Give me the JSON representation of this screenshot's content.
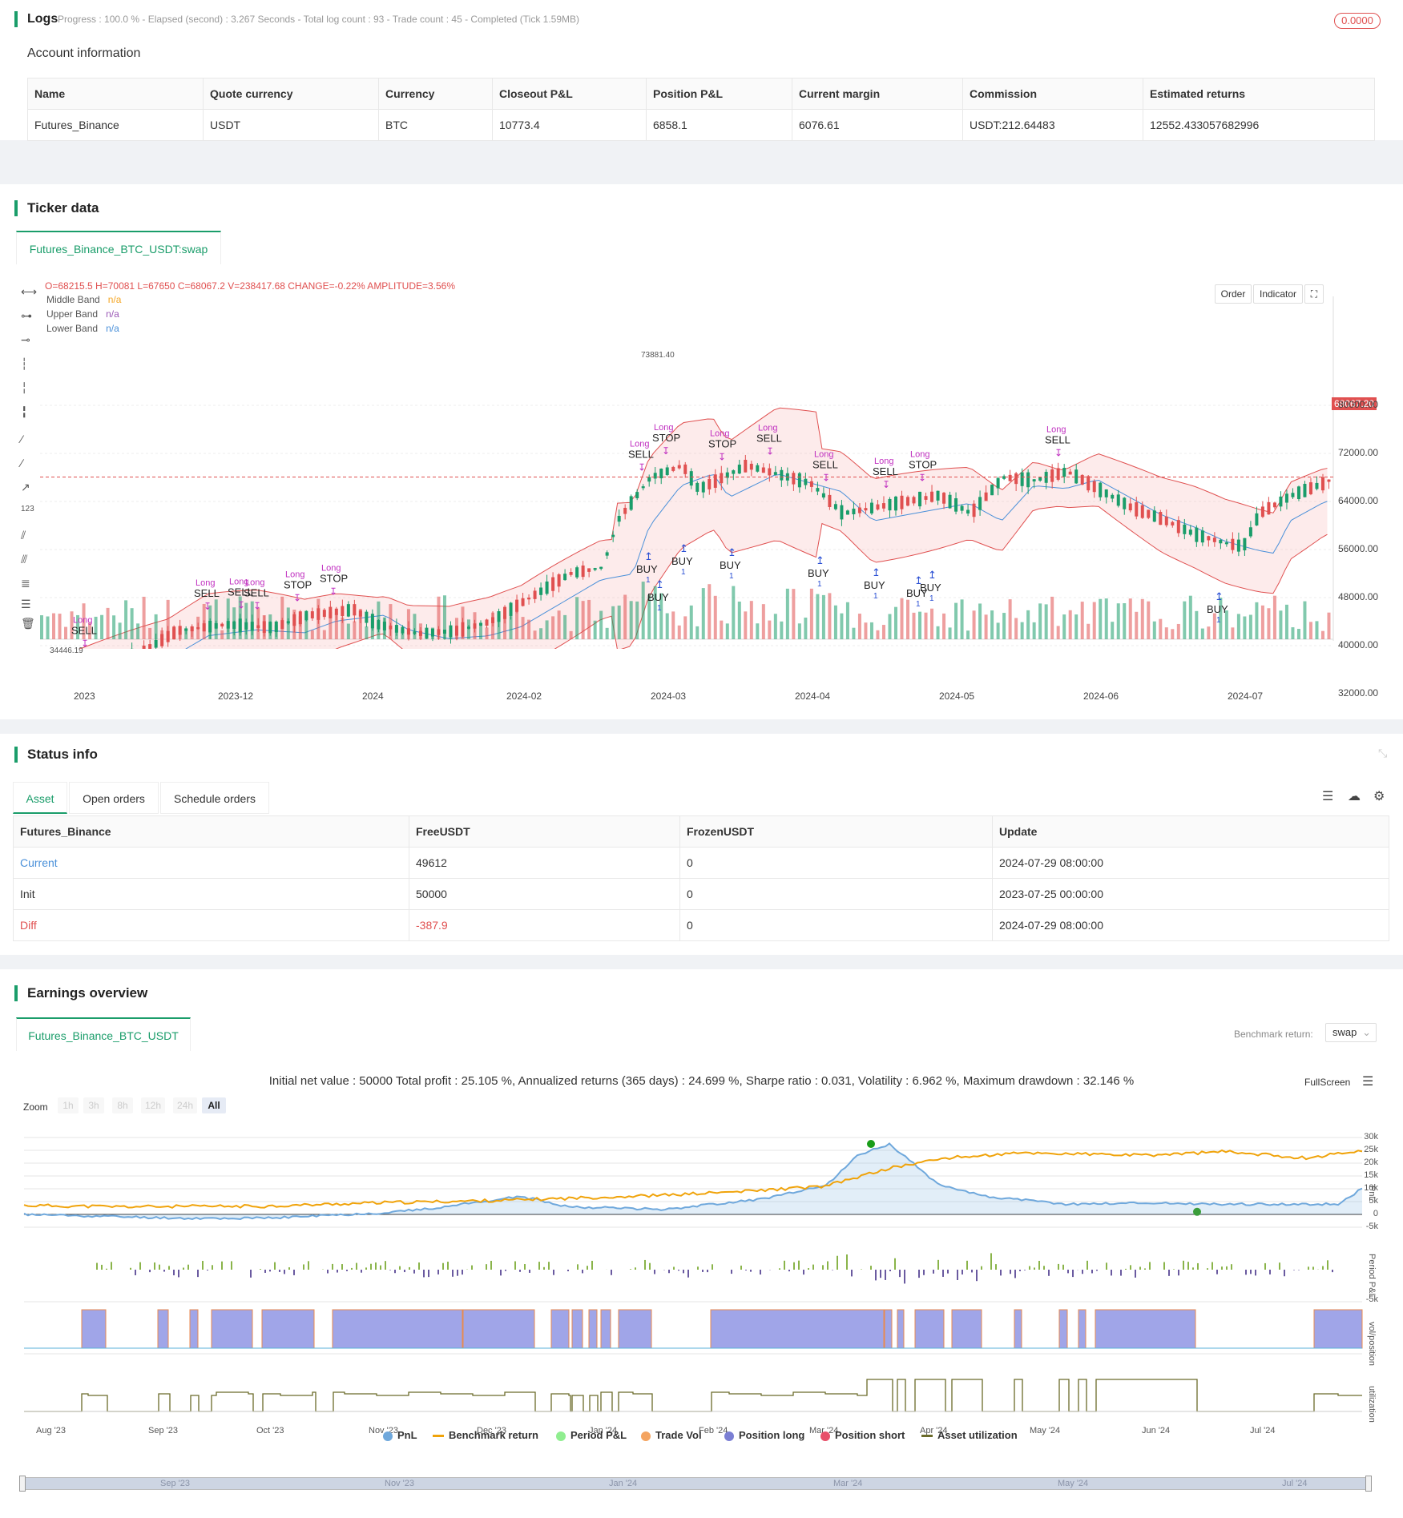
{
  "logs": {
    "title": "Logs",
    "progress": "Progress : 100.0 % - Elapsed (second) : 3.267  Seconds - Total log count : 93 - Trade count : 45 - Completed (Tick 1.59MB)",
    "badge": "0.0000"
  },
  "account": {
    "title": "Account information",
    "headers": [
      "Name",
      "Quote currency",
      "Currency",
      "Closeout P&L",
      "Position P&L",
      "Current margin",
      "Commission",
      "Estimated returns"
    ],
    "row": [
      "Futures_Binance",
      "USDT",
      "BTC",
      "10773.4",
      "6858.1",
      "6076.61",
      "USDT:212.64483",
      "12552.433057682996"
    ]
  },
  "ticker": {
    "title": "Ticker data",
    "tab": "Futures_Binance_BTC_USDT:swap",
    "ohlc": "O=68215.5 H=70081 L=67650 C=68067.2 V=238417.68 CHANGE=-0.22% AMPLITUDE=3.56%",
    "legend": [
      {
        "name": "Middle Band",
        "value": "n/a",
        "color": "#f5a623"
      },
      {
        "name": "Upper Band",
        "value": "n/a",
        "color": "#9b59b6"
      },
      {
        "name": "Lower Band",
        "value": "n/a",
        "color": "#4a90d9"
      }
    ],
    "buttons": {
      "order": "Order",
      "indicator": "Indicator"
    },
    "price_tag": "68067.20",
    "low_tag": "34446.19",
    "high_tag": "73881.40",
    "y_ticks": [
      "80000.00",
      "72000.00",
      "64000.00",
      "56000.00",
      "48000.00",
      "40000.00",
      "32000.00"
    ],
    "x_ticks": [
      "2023",
      "2023-12",
      "2024",
      "2024-02",
      "2024-03",
      "2024-04",
      "2024-05",
      "2024-06",
      "2024-07"
    ]
  },
  "status": {
    "title": "Status info",
    "tabs": [
      "Asset",
      "Open orders",
      "Schedule orders"
    ],
    "headers": [
      "Futures_Binance",
      "FreeUSDT",
      "FrozenUSDT",
      "Update"
    ],
    "rows": [
      [
        "Current",
        "49612",
        "0",
        "2024-07-29 08:00:00"
      ],
      [
        "Init",
        "50000",
        "0",
        "2023-07-25 00:00:00"
      ],
      [
        "Diff",
        "-387.9",
        "0",
        "2024-07-29 08:00:00"
      ]
    ]
  },
  "earnings": {
    "title": "Earnings overview",
    "tab": "Futures_Binance_BTC_USDT",
    "benchmark_label": "Benchmark return:",
    "benchmark_value": "swap",
    "summary": "Initial net value : 50000 Total profit : 25.105 %, Annualized returns (365 days) : 24.699 %, Sharpe ratio : 0.031, Volatility : 6.962 %, Maximum drawdown : 32.146 %",
    "fullscreen": "FullScreen",
    "zoom_label": "Zoom",
    "zoom_options": [
      "1h",
      "3h",
      "8h",
      "12h",
      "24h",
      "All"
    ],
    "pnl_ticks": [
      "30k",
      "25k",
      "20k",
      "15k",
      "10k",
      "5k",
      "0",
      "-5k"
    ],
    "period_ticks": [
      "-5k"
    ],
    "axis_titles": [
      "PnL",
      "Period P&L",
      "vol/position",
      "utilization"
    ],
    "x_ticks": [
      "Aug '23",
      "Sep '23",
      "Oct '23",
      "Nov '23",
      "Dec '23",
      "Jan '24",
      "Feb '24",
      "Mar '24",
      "Apr '24",
      "May '24",
      "Jun '24",
      "Jul '24"
    ],
    "nav_ticks": [
      "Sep '23",
      "Nov '23",
      "Jan '24",
      "Mar '24",
      "May '24",
      "Jul '24"
    ],
    "legend": [
      {
        "name": "PnL",
        "color": "#6fa8dc",
        "kind": "dot"
      },
      {
        "name": "Benchmark return",
        "color": "#f0a30a",
        "kind": "line"
      },
      {
        "name": "Period P&L",
        "color": "#90ee90",
        "kind": "dot"
      },
      {
        "name": "Trade Vol",
        "color": "#f4a460",
        "kind": "dot"
      },
      {
        "name": "Position long",
        "color": "#7b7fd4",
        "kind": "dot"
      },
      {
        "name": "Position short",
        "color": "#e8506a",
        "kind": "dot"
      },
      {
        "name": "Asset utilization",
        "color": "#6b6b2a",
        "kind": "line"
      }
    ]
  }
}
